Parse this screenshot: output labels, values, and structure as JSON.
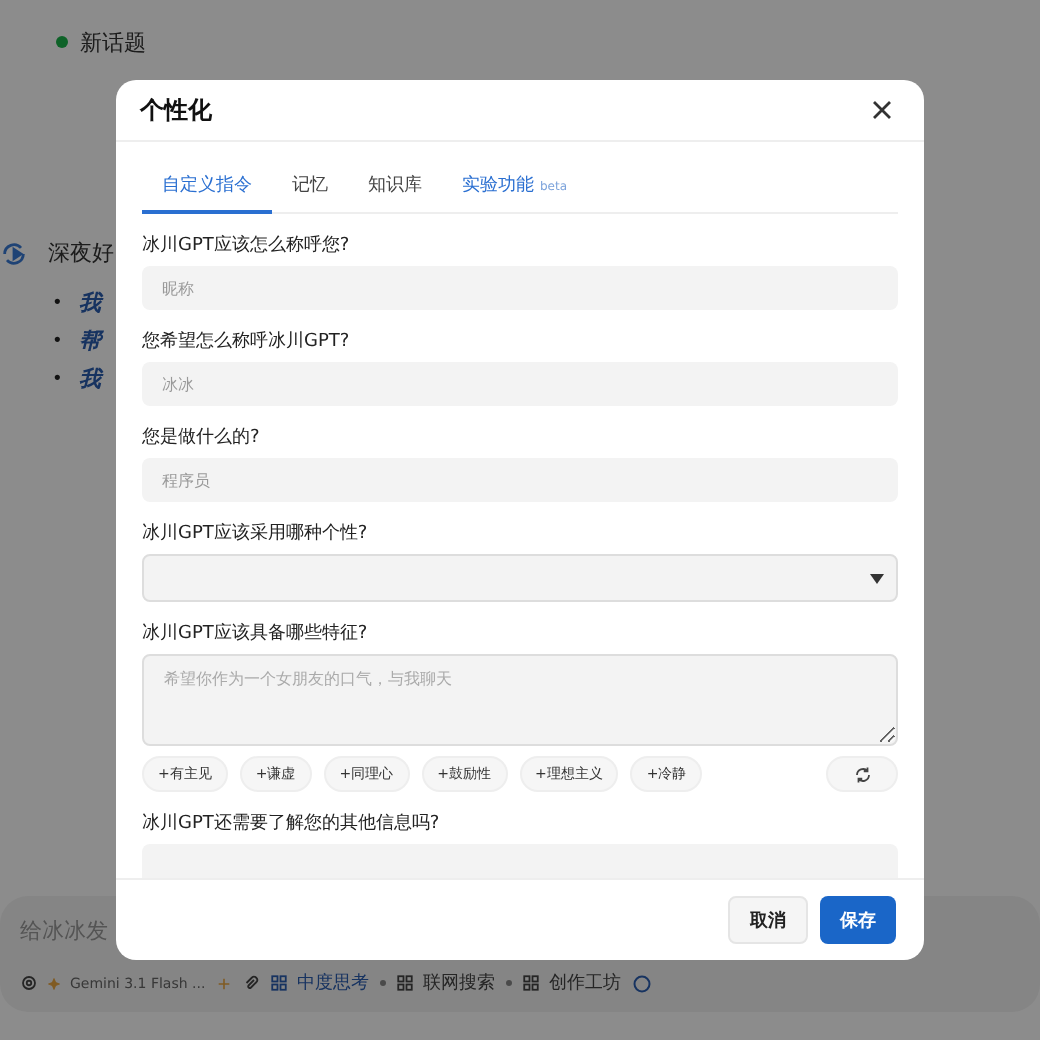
{
  "background": {
    "topic": "新话题",
    "greeting": "深夜好",
    "marker": "•",
    "suggestions": [
      "我",
      "帮",
      "我"
    ],
    "composer": {
      "placeholder": "给冰冰发",
      "model": "Gemini 3.1 Flash ...",
      "tools": [
        {
          "label": "中度思考",
          "active": true
        },
        {
          "label": "联网搜索",
          "active": false
        },
        {
          "label": "创作工坊",
          "active": false
        }
      ]
    }
  },
  "modal": {
    "title": "个性化",
    "tabs": [
      {
        "label": "自定义指令",
        "selected": true,
        "kind": "normal"
      },
      {
        "label": "记忆",
        "selected": false,
        "kind": "normal"
      },
      {
        "label": "知识库",
        "selected": false,
        "kind": "normal"
      },
      {
        "label": "实验功能",
        "badge": "beta",
        "selected": false,
        "kind": "labs"
      }
    ],
    "questions": [
      {
        "kind": "input",
        "label": "冰川GPT应该怎么称呼您?",
        "placeholder": "昵称"
      },
      {
        "kind": "input",
        "label": "您希望怎么称呼冰川GPT?",
        "placeholder": "冰冰"
      },
      {
        "kind": "input",
        "label": "您是做什么的?",
        "placeholder": "程序员"
      },
      {
        "kind": "select",
        "label": "冰川GPT应该采用哪种个性?"
      },
      {
        "kind": "textarea",
        "label": "冰川GPT应该具备哪些特征?",
        "placeholder": "希望你作为一个女朋友的口气，与我聊天",
        "chips": [
          "+有主见",
          "+谦虚",
          "+同理心",
          "+鼓励性",
          "+理想主义",
          "+冷静"
        ]
      },
      {
        "kind": "input",
        "label": "冰川GPT还需要了解您的其他信息吗?"
      }
    ],
    "buttons": [
      {
        "label": "取消",
        "kind": "secondary"
      },
      {
        "label": "保存",
        "kind": "primary"
      }
    ]
  }
}
